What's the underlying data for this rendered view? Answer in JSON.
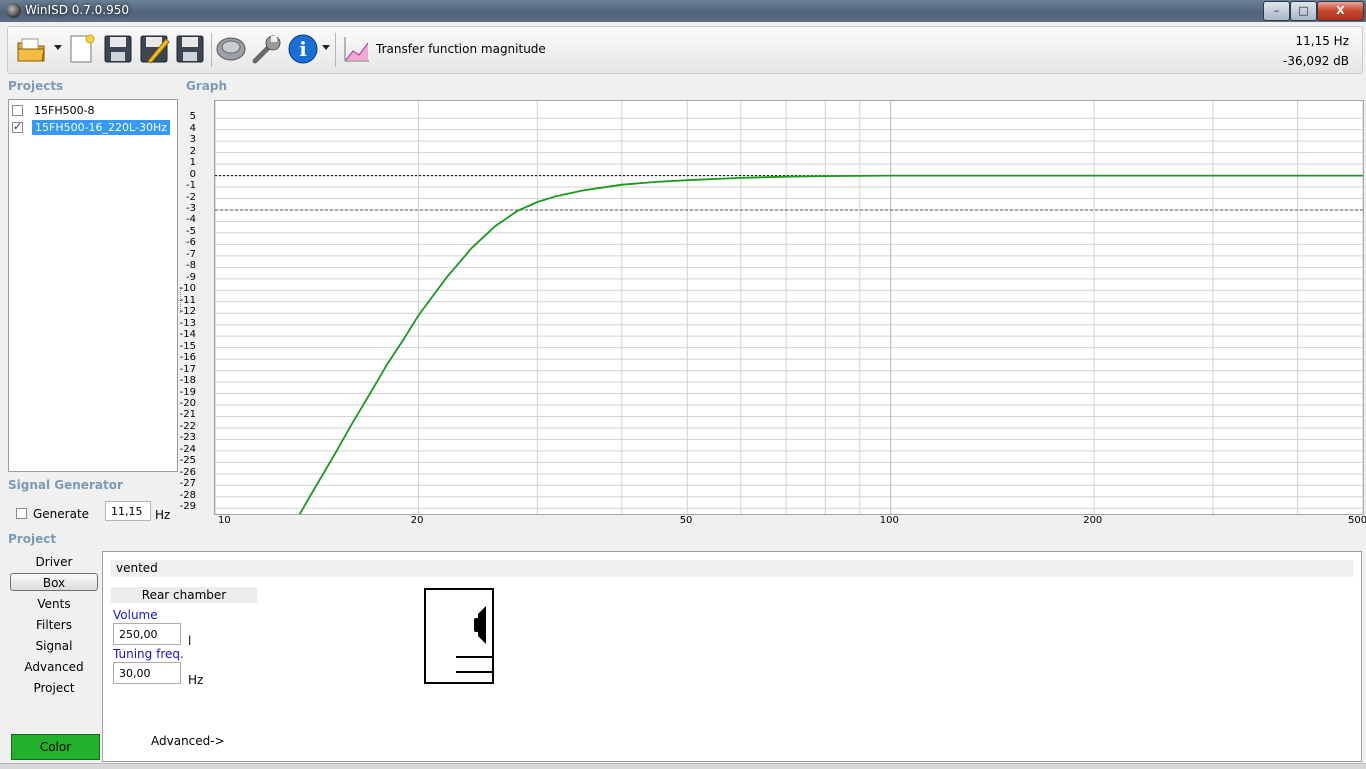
{
  "window": {
    "title": "WinISD 0.7.0.950",
    "minimize": "–",
    "maximize": "□",
    "close": "X"
  },
  "toolbar": {
    "icons": [
      "open-folder-icon",
      "new-document-icon",
      "save-icon",
      "edit-icon",
      "save-as-icon",
      "speaker-icon",
      "wrench-icon",
      "info-icon",
      "graph-icon"
    ],
    "graph_selector_label": "Transfer function magnitude",
    "readout_freq": "11,15 Hz",
    "readout_level": "-36,092 dB"
  },
  "projects": {
    "label": "Projects",
    "items": [
      {
        "name": "15FH500-8",
        "checked": false,
        "selected": false
      },
      {
        "name": "15FH500-16_220L-30Hz",
        "checked": true,
        "selected": true
      }
    ]
  },
  "graph": {
    "label": "Graph"
  },
  "chart_data": {
    "type": "line",
    "title": "",
    "xlabel": "",
    "ylabel": "",
    "xscale": "log",
    "xlim": [
      10,
      500
    ],
    "ylim": [
      -30,
      6
    ],
    "yticks": [
      5,
      4,
      3,
      2,
      1,
      0,
      -1,
      -2,
      -3,
      -4,
      -5,
      -6,
      -7,
      -8,
      -9,
      -10,
      -11,
      -12,
      -13,
      -14,
      -15,
      -16,
      -17,
      -18,
      -19,
      -20,
      -21,
      -22,
      -23,
      -24,
      -25,
      -26,
      -27,
      -28,
      -29
    ],
    "xticks": [
      10,
      20,
      50,
      100,
      200,
      500
    ],
    "grid": true,
    "reference_lines_db": [
      0,
      -3
    ],
    "series": [
      {
        "color": "#1a9a1a",
        "x": [
          13.2,
          14,
          15,
          16,
          17,
          18,
          19,
          20,
          22,
          24,
          26,
          28,
          30,
          32,
          35,
          40,
          45,
          50,
          60,
          70,
          80,
          100,
          200,
          500
        ],
        "y": [
          -30,
          -27.4,
          -24.4,
          -21.5,
          -18.9,
          -16.4,
          -14.3,
          -12.2,
          -8.9,
          -6.3,
          -4.4,
          -3.1,
          -2.3,
          -1.8,
          -1.3,
          -0.8,
          -0.55,
          -0.4,
          -0.2,
          -0.1,
          -0.05,
          0,
          0,
          0
        ]
      }
    ]
  },
  "signal_generator": {
    "label": "Signal Generator",
    "generate_label": "Generate",
    "generate_checked": false,
    "frequency": "11,15",
    "unit": "Hz"
  },
  "project": {
    "label": "Project",
    "nav": [
      "Driver",
      "Box",
      "Vents",
      "Filters",
      "Signal",
      "Advanced",
      "Project"
    ],
    "active": "Box",
    "color_label": "Color",
    "color_value": "#22b12a"
  },
  "box": {
    "type": "vented",
    "rear_chamber_label": "Rear chamber",
    "volume_label": "Volume",
    "volume_value": "250,00",
    "volume_unit": "l",
    "tuning_label": "Tuning freq.",
    "tuning_value": "30,00",
    "tuning_unit": "Hz",
    "advanced_link": "Advanced->"
  }
}
